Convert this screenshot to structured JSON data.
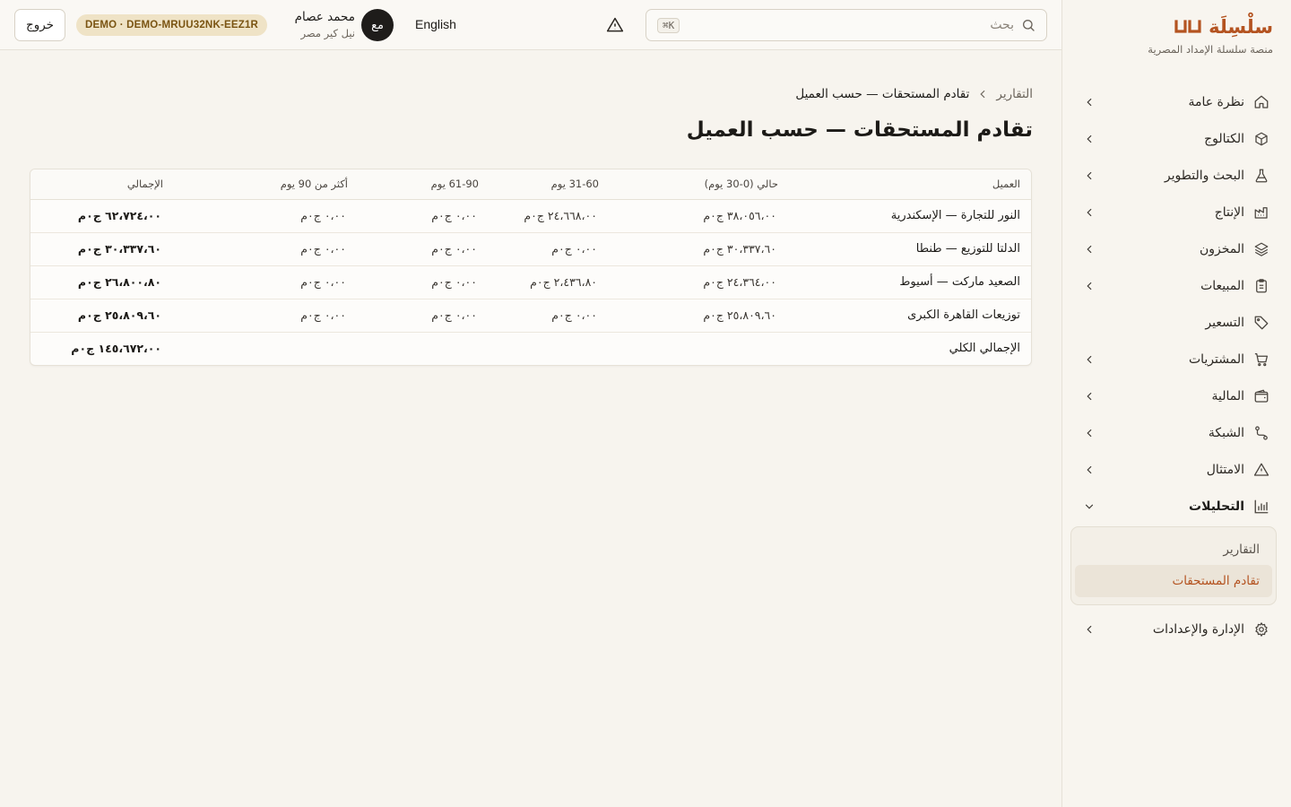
{
  "brand": {
    "name": "سلْسِلَة",
    "tagline": "منصة سلسلة الإمداد المصرية",
    "accent": "#b45320"
  },
  "topbar": {
    "search_placeholder": "بحث",
    "search_shortcut": "⌘K",
    "language_label": "English",
    "user_initials": "مع",
    "user_name": "محمد عصام",
    "user_company": "نيل كير مصر",
    "demo_badge": "DEMO · DEMO-MRUU32NK-EEZ1R",
    "logout_label": "خروج"
  },
  "sidebar": {
    "items": [
      {
        "label": "نظرة عامة",
        "icon": "home-icon"
      },
      {
        "label": "الكتالوج",
        "icon": "box-icon"
      },
      {
        "label": "البحث والتطوير",
        "icon": "flask-icon"
      },
      {
        "label": "الإنتاج",
        "icon": "factory-icon"
      },
      {
        "label": "المخزون",
        "icon": "layers-icon"
      },
      {
        "label": "المبيعات",
        "icon": "clipboard-icon"
      },
      {
        "label": "التسعير",
        "icon": "tag-icon"
      },
      {
        "label": "المشتريات",
        "icon": "cart-icon"
      },
      {
        "label": "المالية",
        "icon": "wallet-icon"
      },
      {
        "label": "الشبكة",
        "icon": "route-icon"
      },
      {
        "label": "الامتثال",
        "icon": "warning-icon"
      },
      {
        "label": "التحليلات",
        "icon": "bar-chart-icon"
      },
      {
        "label": "الإدارة والإعدادات",
        "icon": "gear-icon"
      }
    ],
    "analytics_sub": [
      {
        "label": "التقارير"
      },
      {
        "label": "تقادم المستحقات"
      }
    ]
  },
  "breadcrumb": {
    "parent": "التقارير",
    "current": "تقادم المستحقات — حسب العميل"
  },
  "page_title": "تقادم المستحقات — حسب العميل",
  "table": {
    "headers": [
      "العميل",
      "حالي (0-30 يوم)",
      "31-60 يوم",
      "61-90 يوم",
      "أكثر من 90 يوم",
      "الإجمالي"
    ],
    "rows": [
      [
        "النور للتجارة — الإسكندرية",
        "٣٨،٠٥٦،٠٠ ج٠م",
        "٢٤،٦٦٨،٠٠ ج٠م",
        "٠،٠٠ ج٠م",
        "٠،٠٠ ج٠م",
        "٦٢،٧٢٤،٠٠ ج٠م"
      ],
      [
        "الدلتا للتوزيع — طنطا",
        "٣٠،٣٣٧،٦٠ ج٠م",
        "٠،٠٠ ج٠م",
        "٠،٠٠ ج٠م",
        "٠،٠٠ ج٠م",
        "٣٠،٣٣٧،٦٠ ج٠م"
      ],
      [
        "الصعيد ماركت — أسيوط",
        "٢٤،٣٦٤،٠٠ ج٠م",
        "٢،٤٣٦،٨٠ ج٠م",
        "٠،٠٠ ج٠م",
        "٠،٠٠ ج٠م",
        "٢٦،٨٠٠،٨٠ ج٠م"
      ],
      [
        "توزيعات القاهرة الكبرى",
        "٢٥،٨٠٩،٦٠ ج٠م",
        "٠،٠٠ ج٠م",
        "٠،٠٠ ج٠م",
        "٠،٠٠ ج٠م",
        "٢٥،٨٠٩،٦٠ ج٠م"
      ]
    ],
    "grand_total_label": "الإجمالي الكلي",
    "grand_total_value": "١٤٥،٦٧٢،٠٠ ج٠م"
  }
}
